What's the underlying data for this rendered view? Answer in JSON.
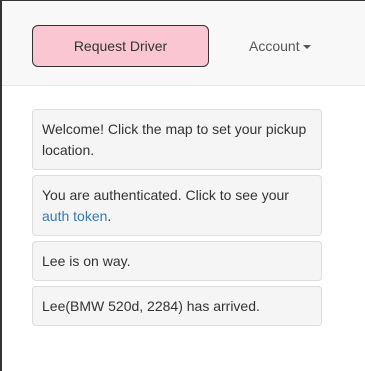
{
  "navbar": {
    "request_button_label": "Request Driver",
    "account_label": "Account"
  },
  "messages": [
    {
      "text": "Welcome! Click the map to set your pickup location."
    },
    {
      "text_before": "You are authenticated. Click to see your ",
      "link_text": "auth token",
      "text_after": "."
    },
    {
      "text": "Lee is on way."
    },
    {
      "text": "Lee(BMW 520d, 2284) has arrived."
    }
  ],
  "colors": {
    "request_button_bg": "#f9c6d1",
    "link": "#337ab7",
    "message_bg": "#f5f5f5",
    "navbar_bg": "#f8f8f8"
  }
}
